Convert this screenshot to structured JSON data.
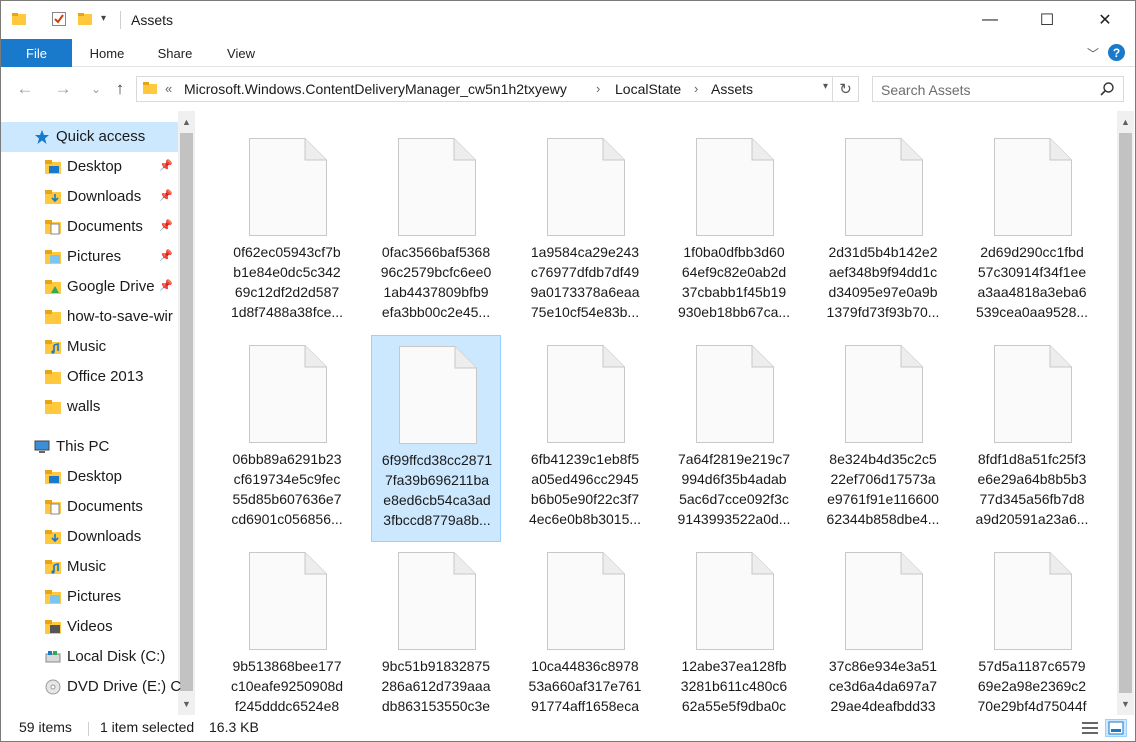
{
  "window": {
    "title": "Assets",
    "buttons": {
      "minimize": "—",
      "maximize": "☐",
      "close": "✕"
    }
  },
  "ribbon": {
    "tabs": [
      "File",
      "Home",
      "Share",
      "View"
    ],
    "collapse_icon": "chevron-down-icon",
    "help": "?"
  },
  "address": {
    "overflow": "«",
    "segments": [
      "Microsoft.Windows.ContentDeliveryManager_cw5n1h2txyewy",
      "LocalState",
      "Assets"
    ],
    "separator": "›",
    "dropdown": "▾",
    "refresh": "↻"
  },
  "search": {
    "placeholder": "Search Assets"
  },
  "nav": {
    "back": "←",
    "forward": "→",
    "recent": "⌄",
    "up": "↑"
  },
  "sidebar": {
    "quick_access": {
      "label": "Quick access",
      "items": [
        {
          "label": "Desktop",
          "pinned": true,
          "icon": "desktop-folder-icon"
        },
        {
          "label": "Downloads",
          "pinned": true,
          "icon": "downloads-folder-icon"
        },
        {
          "label": "Documents",
          "pinned": true,
          "icon": "documents-folder-icon"
        },
        {
          "label": "Pictures",
          "pinned": true,
          "icon": "pictures-folder-icon"
        },
        {
          "label": "Google Drive",
          "pinned": true,
          "icon": "google-drive-folder-icon"
        },
        {
          "label": "how-to-save-wir",
          "pinned": false,
          "icon": "folder-icon"
        },
        {
          "label": "Music",
          "pinned": false,
          "icon": "music-folder-icon"
        },
        {
          "label": "Office 2013",
          "pinned": false,
          "icon": "folder-icon"
        },
        {
          "label": "walls",
          "pinned": false,
          "icon": "folder-icon"
        }
      ]
    },
    "this_pc": {
      "label": "This PC",
      "items": [
        {
          "label": "Desktop",
          "icon": "desktop-folder-icon"
        },
        {
          "label": "Documents",
          "icon": "documents-folder-icon"
        },
        {
          "label": "Downloads",
          "icon": "downloads-folder-icon"
        },
        {
          "label": "Music",
          "icon": "music-folder-icon"
        },
        {
          "label": "Pictures",
          "icon": "pictures-folder-icon"
        },
        {
          "label": "Videos",
          "icon": "videos-folder-icon"
        },
        {
          "label": "Local Disk (C:)",
          "icon": "local-disk-icon"
        },
        {
          "label": "DVD Drive (E:) C",
          "icon": "dvd-drive-icon"
        }
      ]
    }
  },
  "files": [
    [
      "0f62ec05943cf7b",
      "b1e84e0dc5c342",
      "69c12df2d2d587",
      "1d8f7488a38fce..."
    ],
    [
      "0fac3566baf5368",
      "96c2579bcfc6ee0",
      "1ab4437809bfb9",
      "efa3bb00c2e45..."
    ],
    [
      "1a9584ca29e243",
      "c76977dfdb7df49",
      "9a0173378a6eaa",
      "75e10cf54e83b..."
    ],
    [
      "1f0ba0dfbb3d60",
      "64ef9c82e0ab2d",
      "37cbabb1f45b19",
      "930eb18bb67ca..."
    ],
    [
      "2d31d5b4b142e2",
      "aef348b9f94dd1c",
      "d34095e97e0a9b",
      "1379fd73f93b70..."
    ],
    [
      "2d69d290cc1fbd",
      "57c30914f34f1ee",
      "a3aa4818a3eba6",
      "539cea0aa9528..."
    ],
    [
      "06bb89a6291b23",
      "cf619734e5c9fec",
      "55d85b607636e7",
      "cd6901c056856..."
    ],
    [
      "6f99ffcd38cc2871",
      "7fa39b696211ba",
      "e8ed6cb54ca3ad",
      "3fbccd8779a8b..."
    ],
    [
      "6fb41239c1eb8f5",
      "a05ed496cc2945",
      "b6b05e90f22c3f7",
      "4ec6e0b8b3015..."
    ],
    [
      "7a64f2819e219c7",
      "994d6f35b4adab",
      "5ac6d7cce092f3c",
      "9143993522a0d..."
    ],
    [
      "8e324b4d35c2c5",
      "22ef706d17573a",
      "e9761f91e116600",
      "62344b858dbe4..."
    ],
    [
      "8fdf1d8a51fc25f3",
      "e6e29a64b8b5b3",
      "77d345a56fb7d8",
      "a9d20591a23a6..."
    ],
    [
      "9b513868bee177",
      "c10eafe9250908d",
      "f245dddc6524e8",
      ""
    ],
    [
      "9bc51b91832875",
      "286a612d739aaa",
      "db863153550c3e",
      ""
    ],
    [
      "10ca44836c8978",
      "53a660af317e761",
      "91774aff1658eca",
      ""
    ],
    [
      "12abe37ea128fb",
      "3281b611c480c6",
      "62a55e5f9dba0c",
      ""
    ],
    [
      "37c86e934e3a51",
      "ce3d6a4da697a7",
      "29ae4deafbdd33",
      ""
    ],
    [
      "57d5a1187c6579",
      "69e2a98e2369c2",
      "70e29bf4d75044f",
      ""
    ]
  ],
  "selected_index": 7,
  "status": {
    "count": "59 items",
    "selected": "1 item selected",
    "size": "16.3 KB"
  },
  "colors": {
    "accent": "#1979ca",
    "selection": "#cce8ff",
    "selection_border": "#99d1ff",
    "folder": "#ffc83d"
  }
}
